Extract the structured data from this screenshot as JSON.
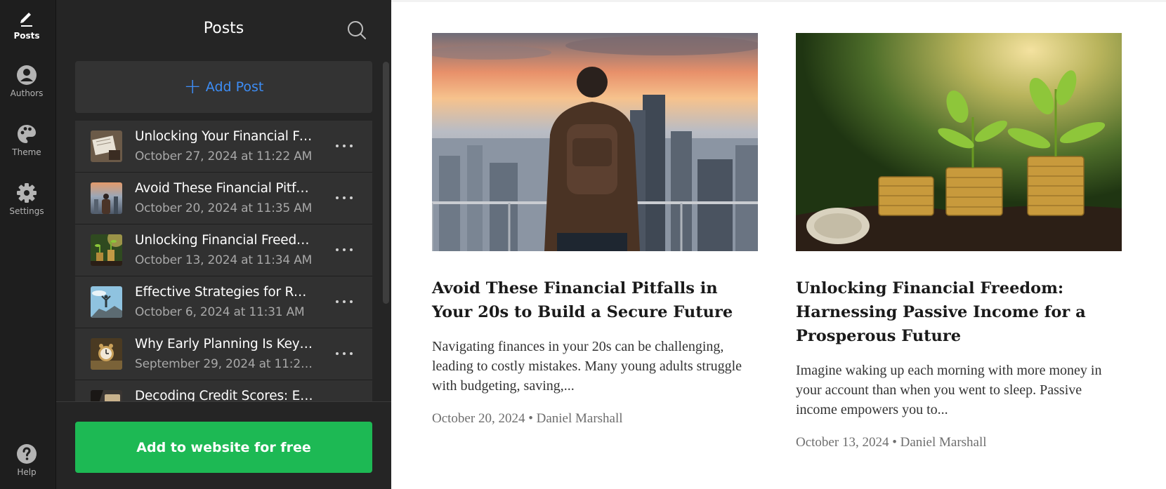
{
  "rail": {
    "items": [
      {
        "label": "Posts",
        "icon": "pen-icon",
        "active": true
      },
      {
        "label": "Authors",
        "icon": "user-icon"
      },
      {
        "label": "Theme",
        "icon": "palette-icon"
      },
      {
        "label": "Settings",
        "icon": "gear-icon"
      }
    ],
    "help": {
      "label": "Help",
      "icon": "help-icon"
    }
  },
  "panel": {
    "title": "Posts",
    "add_post_label": "Add Post",
    "posts": [
      {
        "title": "Unlocking Your Financial Fu...",
        "date": "October 27, 2024 at 11:22 AM",
        "thumb": "notebook"
      },
      {
        "title": "Avoid These Financial Pitfal...",
        "date": "October 20, 2024 at 11:35 AM",
        "thumb": "city"
      },
      {
        "title": "Unlocking Financial Freedo...",
        "date": "October 13, 2024 at 11:34 AM",
        "thumb": "plants"
      },
      {
        "title": "Effective Strategies for Rapi...",
        "date": "October 6, 2024 at 11:31 AM",
        "thumb": "summit"
      },
      {
        "title": "Why Early Planning Is Key t...",
        "date": "September 29, 2024 at 11:25 ...",
        "thumb": "clock"
      },
      {
        "title": "Decoding Credit Scores: Es...",
        "date": "",
        "thumb": "card"
      }
    ],
    "cta_label": "Add to website for free"
  },
  "preview": {
    "cards": [
      {
        "title": "Avoid These Financial Pitfalls in Your 20s to Build a Secure Future",
        "excerpt": "Navigating finances in your 20s can be challenging, leading to costly mistakes. Many young adults struggle with budgeting, saving,...",
        "meta": "October 20, 2024 • Daniel Marshall",
        "image": "man-overlooking-city"
      },
      {
        "title": "Unlocking Financial Freedom: Harnessing Passive Income for a Prosperous Future",
        "excerpt": "Imagine waking up each morning with more money in your account than when you went to sleep. Passive income empowers you to...",
        "meta": "October 13, 2024 • Daniel Marshall",
        "image": "plants-on-coins"
      }
    ]
  },
  "colors": {
    "accent_blue": "#3d8df5",
    "cta_green": "#1db954",
    "panel_bg": "#252525",
    "rail_bg": "#1e1e1e"
  }
}
